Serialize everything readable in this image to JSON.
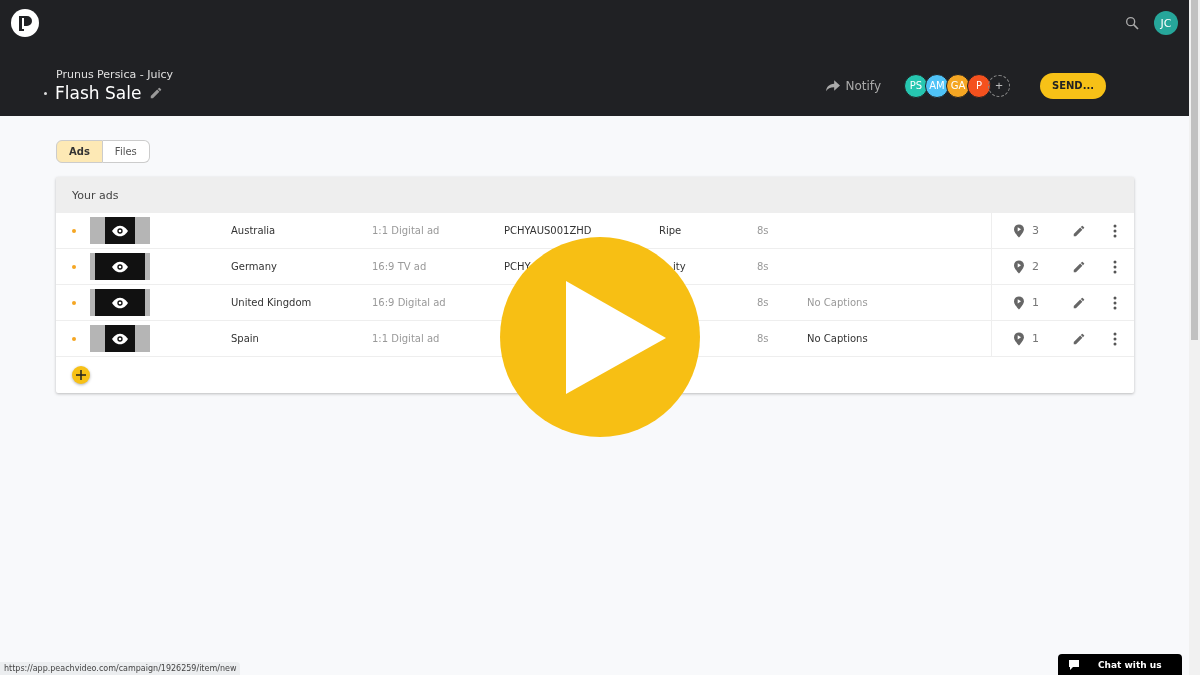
{
  "header": {
    "user_initials": "JC",
    "campaign": "Prunus Persica - Juicy",
    "title": "Flash Sale",
    "notify": "Notify",
    "collaborators": [
      {
        "initials": "PS",
        "color": "#26c6b0"
      },
      {
        "initials": "AM",
        "color": "#4fc3f7"
      },
      {
        "initials": "GA",
        "color": "#f5a623"
      },
      {
        "initials": "P",
        "color": "#f4511e"
      }
    ],
    "add_collaborator": "+",
    "send": "SEND..."
  },
  "tabs": [
    {
      "label": "Ads",
      "selected": true
    },
    {
      "label": "Files",
      "selected": false
    }
  ],
  "ads_panel": {
    "title": "Your ads",
    "rows": [
      {
        "country": "Australia",
        "format": "1:1 Digital ad",
        "code": "PCHYAUS001ZHD",
        "tag": "Ripe",
        "duration": "8s",
        "locations": "3",
        "square": true
      },
      {
        "country": "Germany",
        "format": "16:9 TV ad",
        "code": "PCHY",
        "tag": "ity",
        "tag_cut": true,
        "duration": "8s",
        "locations": "2",
        "square": false
      },
      {
        "country": "United Kingdom",
        "format": "16:9 Digital ad",
        "duration": "8s",
        "captions": "No Captions",
        "captions_muted": true,
        "locations": "1",
        "square": false
      },
      {
        "country": "Spain",
        "format": "1:1 Digital ad",
        "duration": "8s",
        "captions": "No Captions",
        "captions_muted": false,
        "locations": "1",
        "square": true
      }
    ]
  },
  "status_url": "https://app.peachvideo.com/campaign/1926259/item/new",
  "chat": "Chat with us"
}
